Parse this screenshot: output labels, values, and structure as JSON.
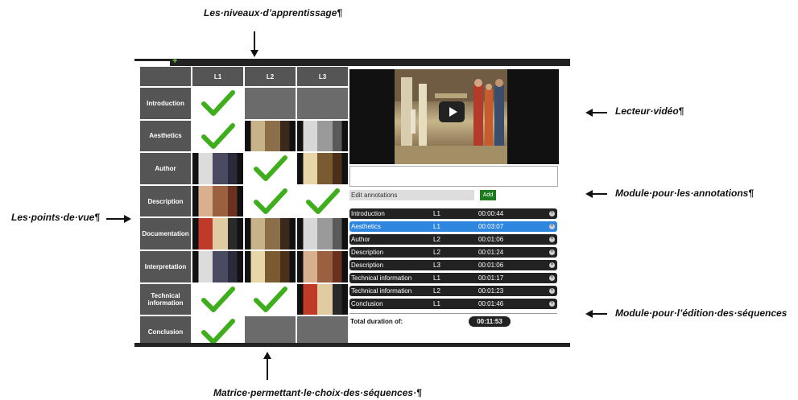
{
  "annotations": {
    "levels": "Les·niveaux·d’apprentissage¶",
    "player": "Lecteur·vidéo¶",
    "annotations": "Module·pour·les·annotations¶",
    "viewpoints": "Les·points·de·vue¶",
    "sequences": "Module·pour·l’édition·des·séquences",
    "matrix": "Matrice·permettant·le·choix·des·séquences·¶"
  },
  "topbar": {
    "plus": "+"
  },
  "matrix": {
    "levels": [
      "L1",
      "L2",
      "L3"
    ],
    "rows": [
      {
        "label": "Introduction",
        "cells": [
          "check",
          "empty",
          "empty"
        ]
      },
      {
        "label": "Aesthetics",
        "cells": [
          "check",
          "thumb",
          "thumb"
        ]
      },
      {
        "label": "Author",
        "cells": [
          "thumb",
          "check",
          "thumb"
        ]
      },
      {
        "label": "Description",
        "cells": [
          "thumb",
          "check",
          "check"
        ]
      },
      {
        "label": "Documentation",
        "cells": [
          "thumb",
          "thumb",
          "thumb"
        ]
      },
      {
        "label": "Interpretation",
        "cells": [
          "thumb",
          "thumb",
          "thumb"
        ]
      },
      {
        "label": "Technical information",
        "cells": [
          "check",
          "check",
          "thumb"
        ]
      },
      {
        "label": "Conclusion",
        "cells": [
          "check",
          "empty",
          "empty"
        ]
      }
    ]
  },
  "editor": {
    "edit_label": "Edit annotations",
    "add_label": "Add"
  },
  "sequences": [
    {
      "name": "Introduction",
      "level": "L1",
      "time": "00:00:44",
      "selected": false
    },
    {
      "name": "Aesthetics",
      "level": "L1",
      "time": "00:03:07",
      "selected": true
    },
    {
      "name": "Author",
      "level": "L2",
      "time": "00:01:06",
      "selected": false
    },
    {
      "name": "Description",
      "level": "L2",
      "time": "00:01:24",
      "selected": false
    },
    {
      "name": "Description",
      "level": "L3",
      "time": "00:01:06",
      "selected": false
    },
    {
      "name": "Technical information",
      "level": "L1",
      "time": "00:01:17",
      "selected": false
    },
    {
      "name": "Technical information",
      "level": "L2",
      "time": "00:01:23",
      "selected": false
    },
    {
      "name": "Conclusion",
      "level": "L1",
      "time": "00:01:46",
      "selected": false
    }
  ],
  "total": {
    "label": "Total duration of:",
    "value": "00:11:53"
  },
  "colors": {
    "check": "#3fae1c",
    "header": "#555555",
    "selected": "#2e86de",
    "add": "#1e7a1e"
  },
  "icons": {
    "remove": "close-icon",
    "play": "play-icon",
    "check": "checkmark-icon"
  }
}
